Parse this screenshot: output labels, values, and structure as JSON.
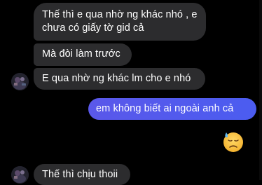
{
  "conversation": {
    "messages": [
      {
        "sender": "other",
        "text": "Thế thì e qua nhờ ng khác nhó , e chưa có giấy tờ gid cả"
      },
      {
        "sender": "other",
        "text": "Mà đòi làm trước"
      },
      {
        "sender": "other",
        "text": "E qua nhờ ng khác lm cho e nhó"
      },
      {
        "sender": "me",
        "text": "em không biết ai ngoài anh cả"
      },
      {
        "sender": "other",
        "text": "Thế thì chịu thoii"
      }
    ],
    "reaction": {
      "emoji_name": "downcast-face-with-sweat",
      "emoji": "😓"
    }
  },
  "colors": {
    "background": "#000000",
    "incoming_bubble": "#2c2c2e",
    "outgoing_bubble": "#4b5cf0",
    "text": "#ffffff"
  }
}
